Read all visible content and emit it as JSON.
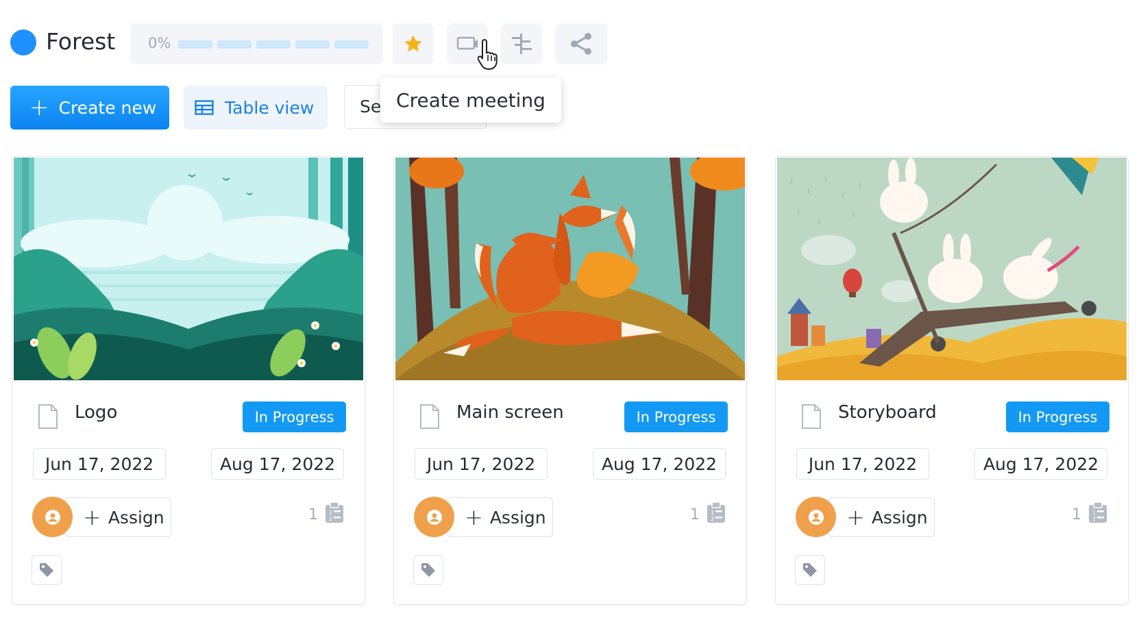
{
  "header": {
    "project_title": "Forest",
    "progress_text": "0%",
    "progress_value": 0,
    "progress_segments": 5,
    "brand_color": "#1e90ff",
    "tools": [
      {
        "name": "star-icon",
        "color": "#f6b314"
      },
      {
        "name": "create-meeting-icon"
      },
      {
        "name": "gantt-icon"
      },
      {
        "name": "share-icon"
      }
    ],
    "tooltip": "Create meeting"
  },
  "toolbar": {
    "create_label": "Create new",
    "table_view_label": "Table view",
    "search_partial_text": "Se"
  },
  "cards": [
    {
      "title": "Logo",
      "status": "In Progress",
      "start_date": "Jun 17, 2022",
      "end_date": "Aug 17, 2022",
      "assign_label": "Assign",
      "task_count": "1",
      "image": "forest-landscape-illustration"
    },
    {
      "title": "Main screen",
      "status": "In Progress",
      "start_date": "Jun 17, 2022",
      "end_date": "Aug 17, 2022",
      "assign_label": "Assign",
      "task_count": "1",
      "image": "fox-family-illustration"
    },
    {
      "title": "Storyboard",
      "status": "In Progress",
      "start_date": "Jun 17, 2022",
      "end_date": "Aug 17, 2022",
      "assign_label": "Assign",
      "task_count": "1",
      "image": "bunnies-scooter-illustration"
    }
  ],
  "colors": {
    "accent": "#1399f3",
    "avatar": "#f0a04b",
    "status_badge": "#1399f3"
  }
}
